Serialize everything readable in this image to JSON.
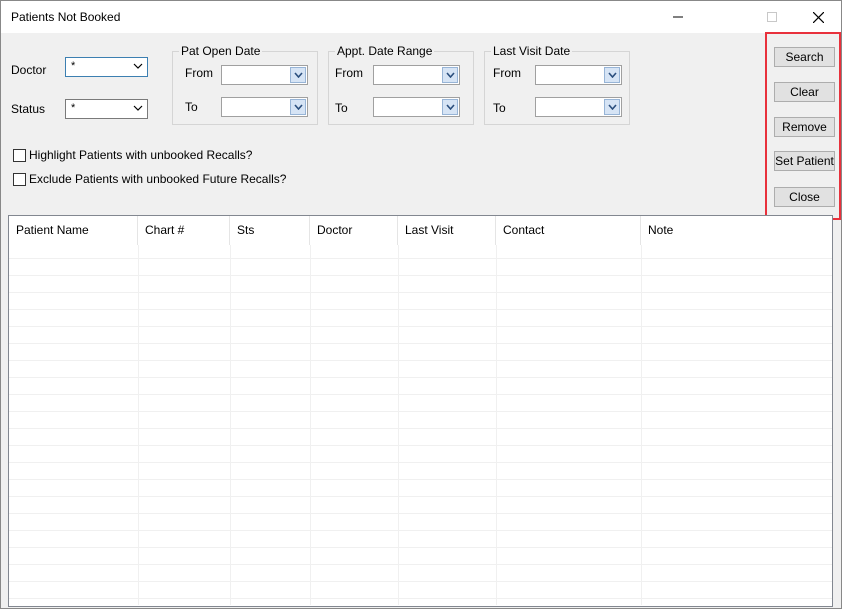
{
  "window": {
    "title": "Patients Not Booked"
  },
  "filters": {
    "doctor_label": "Doctor",
    "doctor_value": "*",
    "status_label": "Status",
    "status_value": "*",
    "pat_open_date": {
      "label": "Pat Open Date",
      "from_label": "From",
      "to_label": "To"
    },
    "appt_date_range": {
      "label": "Appt. Date Range",
      "from_label": "From",
      "to_label": "To"
    },
    "last_visit_date": {
      "label": "Last Visit Date",
      "from_label": "From",
      "to_label": "To"
    }
  },
  "options": {
    "highlight_recalls": "Highlight Patients with unbooked Recalls?",
    "exclude_future_recalls": "Exclude Patients with unbooked Future Recalls?"
  },
  "buttons": {
    "search": "Search",
    "clear": "Clear",
    "remove": "Remove",
    "set_patient": "Set Patient",
    "close": "Close"
  },
  "table": {
    "columns": [
      "Patient Name",
      "Chart #",
      "Sts",
      "Doctor",
      "Last Visit",
      "Contact",
      "Note"
    ]
  },
  "colors": {
    "highlight_border": "#e8313c",
    "dropdown_button": "#d6e4f5"
  }
}
